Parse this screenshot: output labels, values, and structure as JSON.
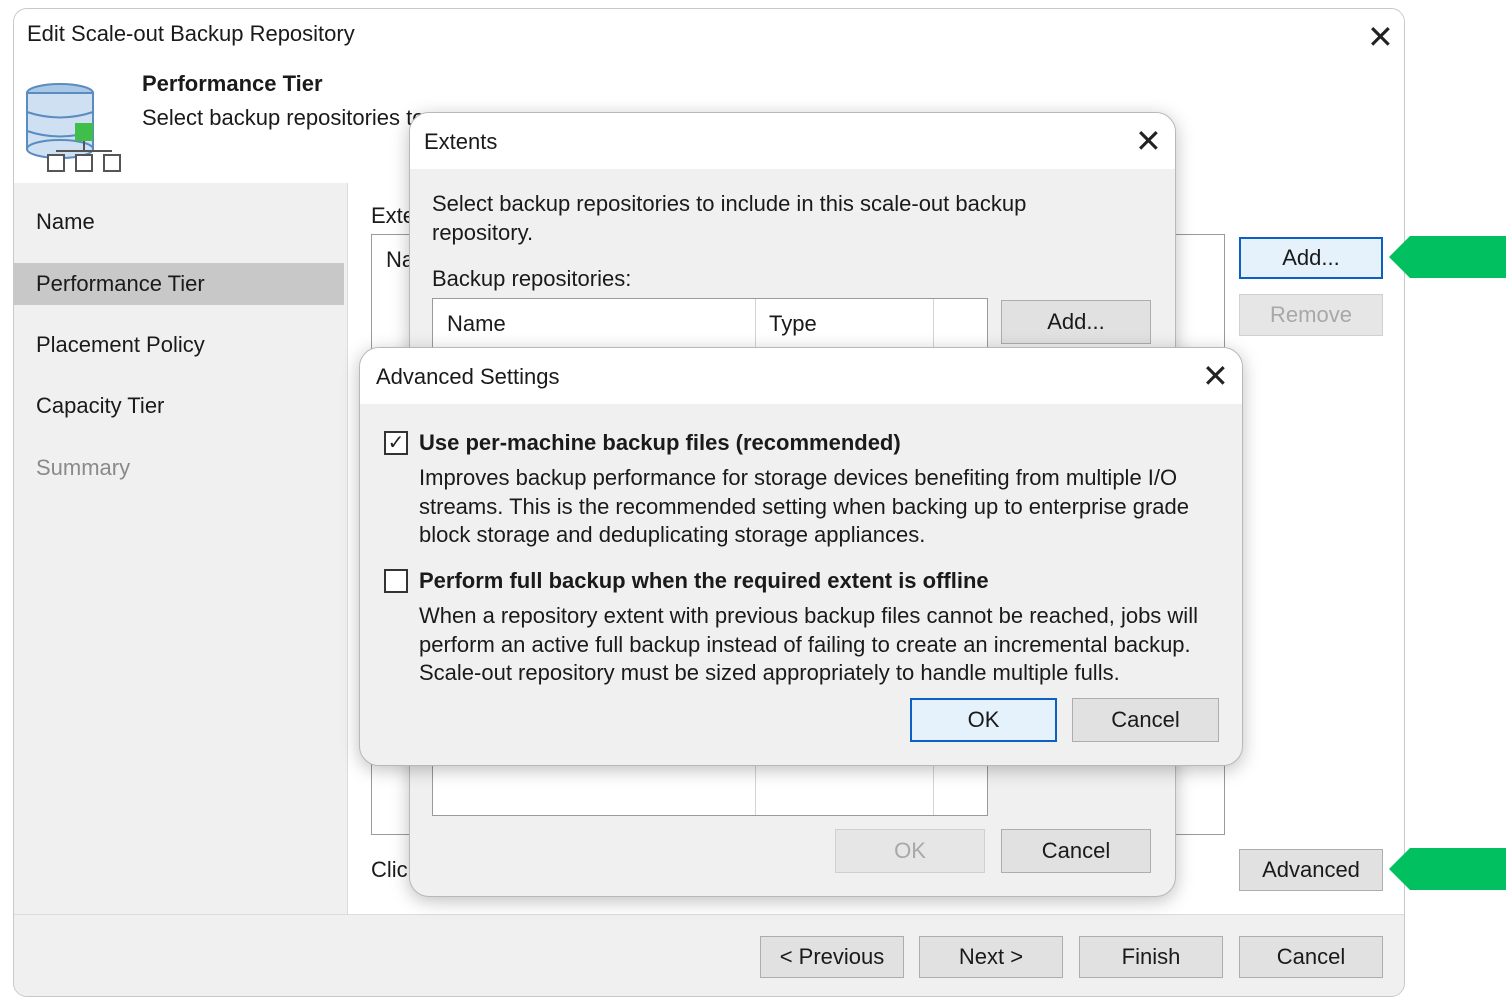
{
  "window": {
    "title": "Edit Scale-out Backup Repository",
    "header": {
      "title": "Performance Tier",
      "description": "Select backup repositories to"
    }
  },
  "nav": {
    "items": [
      {
        "label": "Name"
      },
      {
        "label": "Performance Tier"
      },
      {
        "label": "Placement Policy"
      },
      {
        "label": "Capacity Tier"
      },
      {
        "label": "Summary"
      }
    ]
  },
  "main": {
    "extents_label": "Exte",
    "list_header": "Na",
    "hint_text": "Clic",
    "add_button": "Add...",
    "remove_button": "Remove",
    "advanced_button": "Advanced"
  },
  "footer": {
    "previous": "< Previous",
    "next": "Next >",
    "finish": "Finish",
    "cancel": "Cancel"
  },
  "extents_dialog": {
    "title": "Extents",
    "description": "Select backup repositories to include in this scale-out backup repository.",
    "list_label": "Backup repositories:",
    "columns": [
      "Name",
      "Type"
    ],
    "add_button": "Add...",
    "ok_button": "OK",
    "cancel_button": "Cancel"
  },
  "advanced_dialog": {
    "title": "Advanced Settings",
    "option1": {
      "label": "Use per-machine backup files (recommended)",
      "checked": true,
      "description": "Improves backup performance for storage devices benefiting from multiple I/O streams. This is the recommended setting when backing up to enterprise grade block storage and deduplicating storage appliances."
    },
    "option2": {
      "label": "Perform full backup when the required extent is offline",
      "checked": false,
      "description": "When a repository extent with previous backup files cannot be reached, jobs will perform an active full backup instead of failing to create an incremental backup. Scale-out repository must be sized appropriately to handle multiple fulls."
    },
    "ok_button": "OK",
    "cancel_button": "Cancel"
  },
  "colors": {
    "accent_blue": "#0b61c3",
    "highlight_green": "#00c060",
    "nav_active": "#c8c8c8"
  },
  "icons": [
    "database-icon",
    "close-icon",
    "checkbox-checked-icon",
    "checkbox-unchecked-icon",
    "arrow-pointer-icon"
  ]
}
